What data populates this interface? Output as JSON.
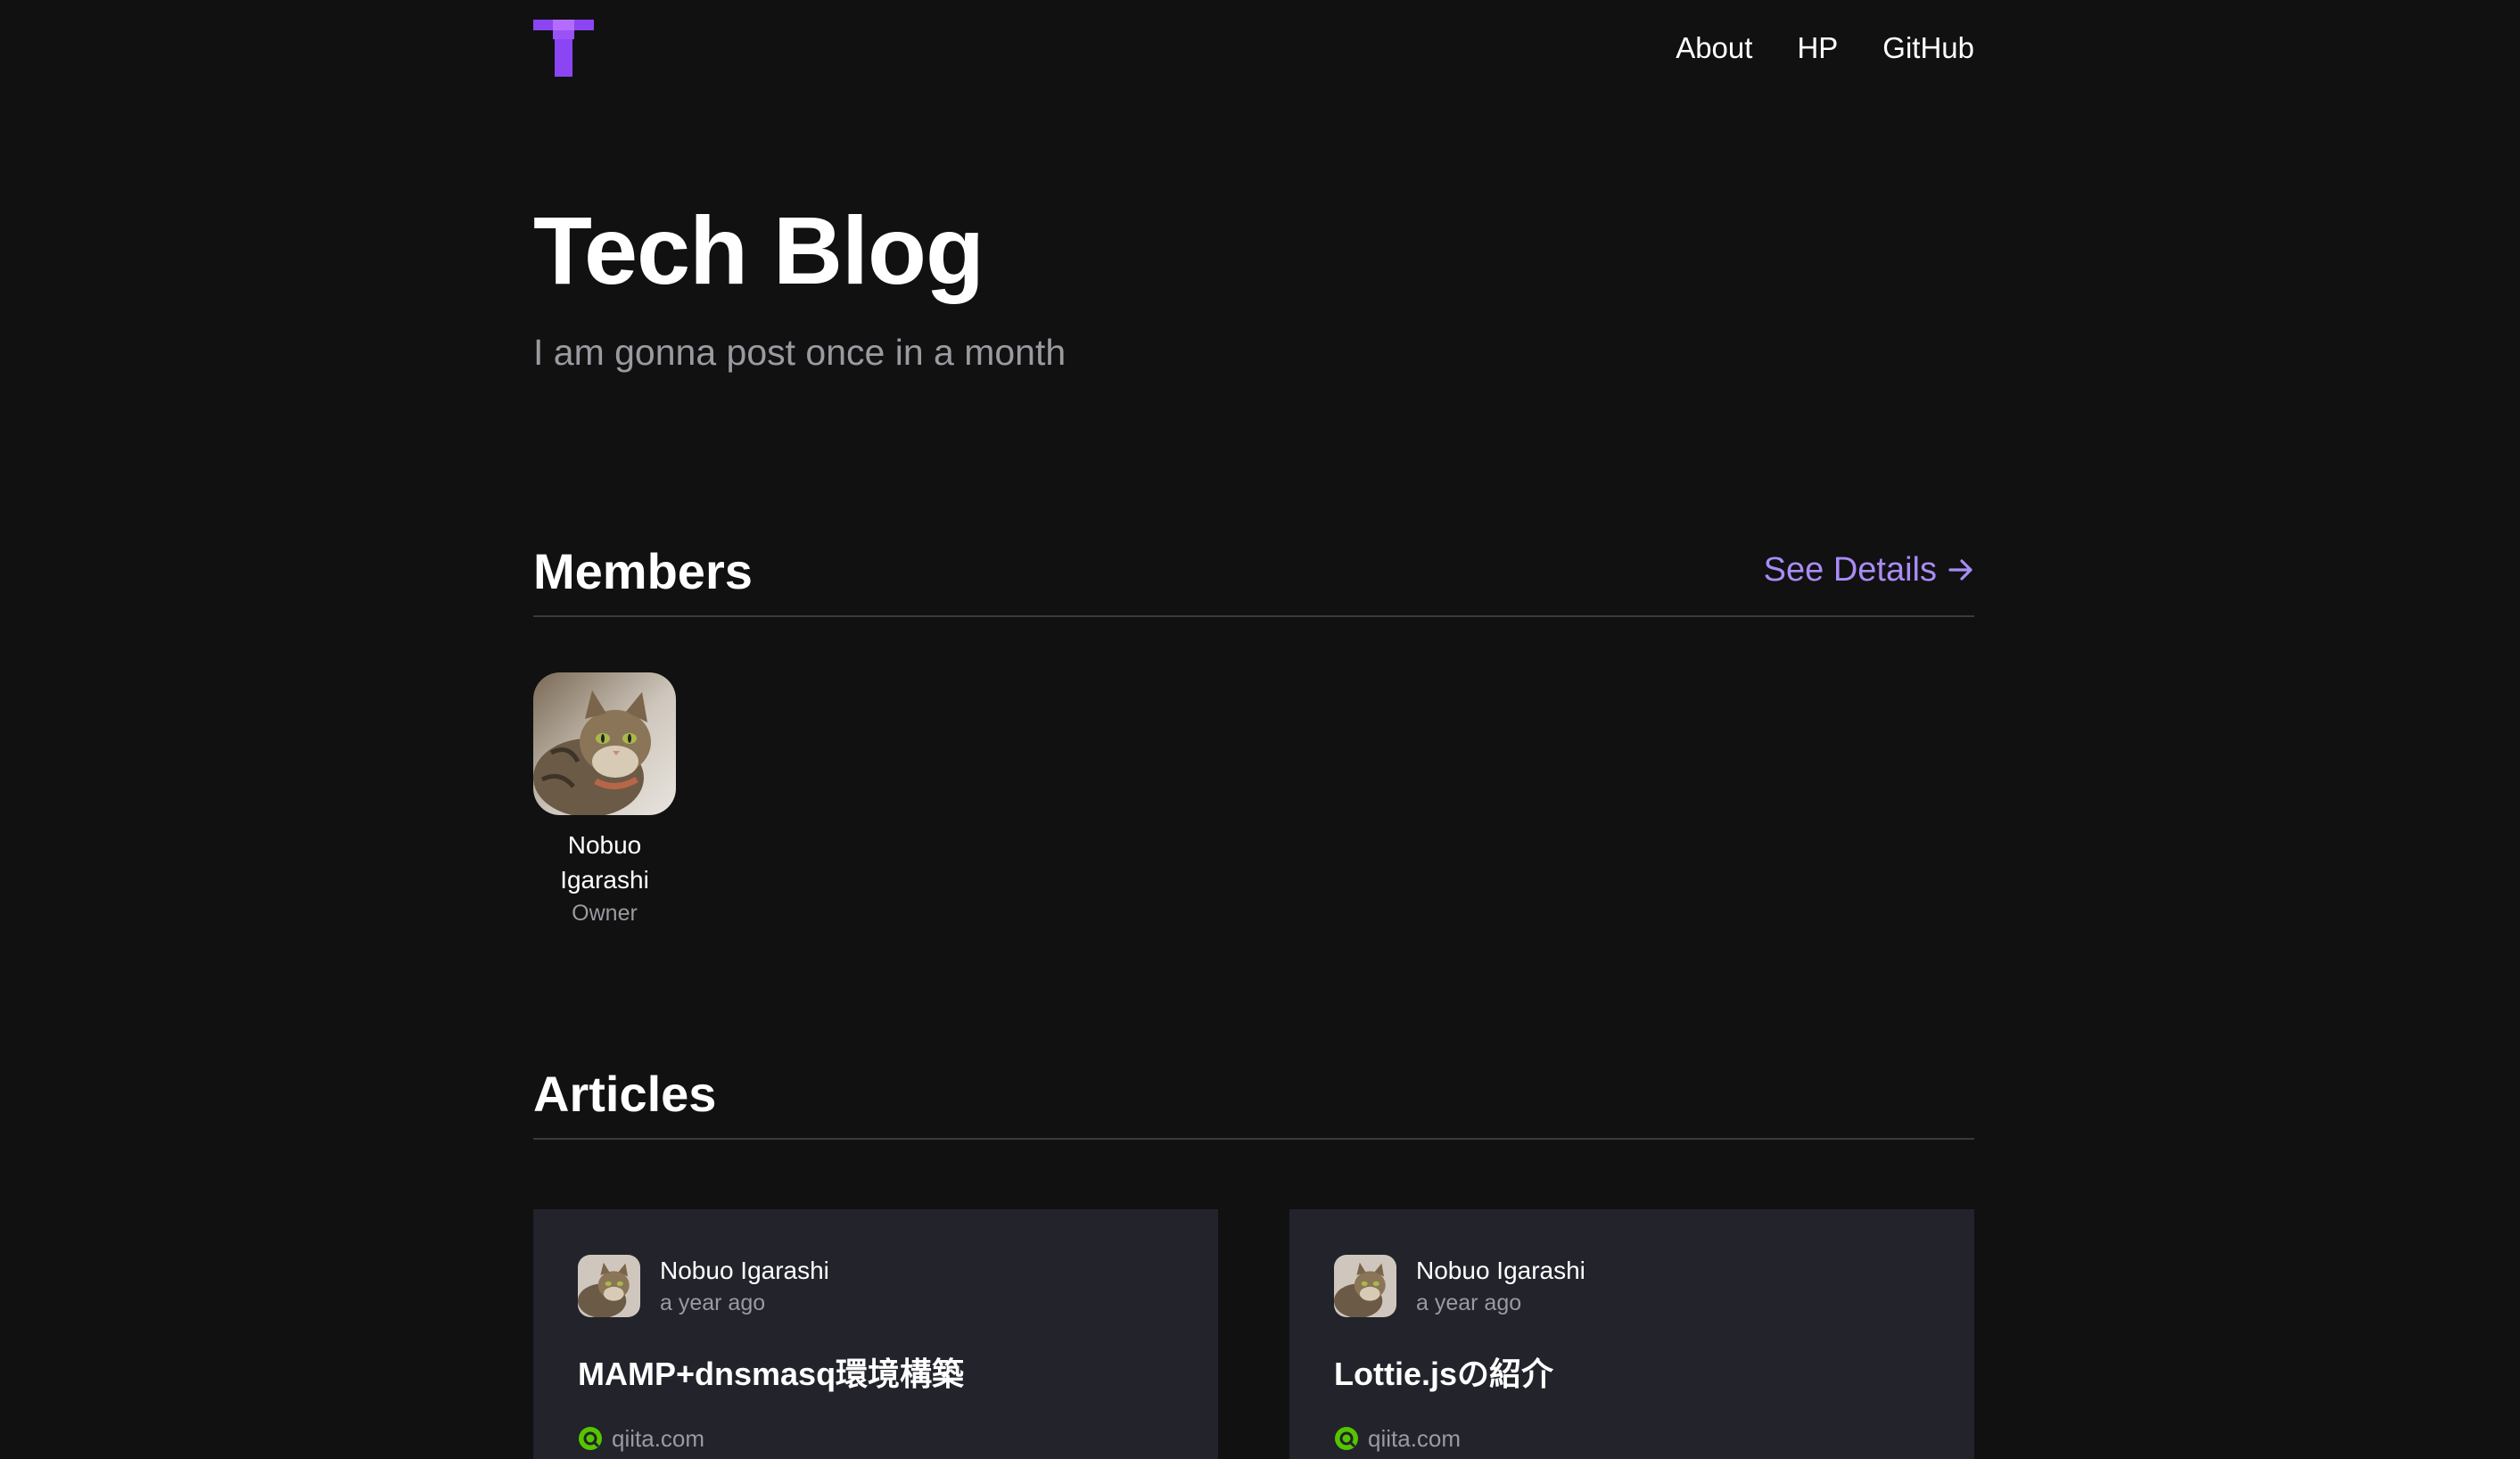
{
  "header": {
    "logo_icon": "purple-pixel-t-logo",
    "nav": [
      {
        "label": "About"
      },
      {
        "label": "HP"
      },
      {
        "label": "GitHub"
      }
    ]
  },
  "hero": {
    "title": "Tech Blog",
    "subtitle": "I am gonna post once in a month"
  },
  "members_section": {
    "title": "Members",
    "see_details_label": "See Details",
    "see_details_icon": "arrow-right-icon",
    "members": [
      {
        "name": "Nobuo Igarashi",
        "role": "Owner",
        "avatar_icon": "cat-avatar"
      }
    ]
  },
  "articles_section": {
    "title": "Articles",
    "articles": [
      {
        "author": "Nobuo Igarashi",
        "time": "a year ago",
        "title": "MAMP+dnsmasq環境構築",
        "source": "qiita.com",
        "source_icon": "qiita-icon"
      },
      {
        "author": "Nobuo Igarashi",
        "time": "a year ago",
        "title": "Lottie.jsの紹介",
        "source": "qiita.com",
        "source_icon": "qiita-icon"
      }
    ]
  },
  "colors": {
    "background": "#111112",
    "accent": "#a98cf5",
    "logo": "#8b45f2",
    "card": "#22232b",
    "muted_text": "#9a9aa0",
    "qiita_green": "#55c500"
  }
}
